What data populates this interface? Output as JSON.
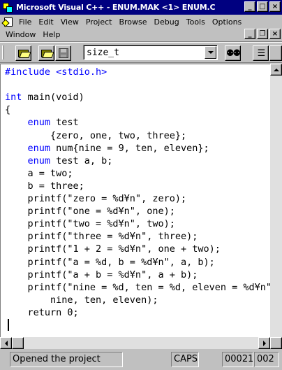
{
  "window": {
    "title": "Microsoft Visual C++ - ENUM.MAK <1> ENUM.C",
    "buttons": {
      "minimize": "_",
      "maximize": "□",
      "close": "×"
    }
  },
  "menu": {
    "row1": [
      "File",
      "Edit",
      "View",
      "Project",
      "Browse",
      "Debug",
      "Tools",
      "Options"
    ],
    "row2": [
      "Window",
      "Help"
    ],
    "doc_buttons": {
      "minimize": "_",
      "restore": "❐",
      "close": "×"
    }
  },
  "toolbar": {
    "combo_value": "size_t"
  },
  "editor": {
    "lines": [
      [
        {
          "t": "#include <stdio.h>",
          "k": true
        }
      ],
      [
        {
          "t": ""
        }
      ],
      [
        {
          "t": "int",
          "k": true
        },
        {
          "t": " main(void)"
        }
      ],
      [
        {
          "t": "{"
        }
      ],
      [
        {
          "t": "    "
        },
        {
          "t": "enum",
          "k": true
        },
        {
          "t": " test"
        }
      ],
      [
        {
          "t": "        {zero, one, two, three};"
        }
      ],
      [
        {
          "t": "    "
        },
        {
          "t": "enum",
          "k": true
        },
        {
          "t": " num{nine = 9, ten, eleven};"
        }
      ],
      [
        {
          "t": "    "
        },
        {
          "t": "enum",
          "k": true
        },
        {
          "t": " test a, b;"
        }
      ],
      [
        {
          "t": "    a = two;"
        }
      ],
      [
        {
          "t": "    b = three;"
        }
      ],
      [
        {
          "t": "    printf(\"zero = %d¥n\", zero);"
        }
      ],
      [
        {
          "t": "    printf(\"one = %d¥n\", one);"
        }
      ],
      [
        {
          "t": "    printf(\"two = %d¥n\", two);"
        }
      ],
      [
        {
          "t": "    printf(\"three = %d¥n\", three);"
        }
      ],
      [
        {
          "t": "    printf(\"1 + 2 = %d¥n\", one + two);"
        }
      ],
      [
        {
          "t": "    printf(\"a = %d, b = %d¥n\", a, b);"
        }
      ],
      [
        {
          "t": "    printf(\"a + b = %d¥n\", a + b);"
        }
      ],
      [
        {
          "t": "    printf(\"nine = %d, ten = %d, eleven = %d¥n\","
        }
      ],
      [
        {
          "t": "        nine, ten, eleven);"
        }
      ],
      [
        {
          "t": "    return 0;"
        }
      ],
      [
        {
          "t": ""
        }
      ]
    ]
  },
  "status": {
    "message": "Opened the project",
    "caps": "CAPS",
    "line": "00021",
    "col": "002"
  }
}
